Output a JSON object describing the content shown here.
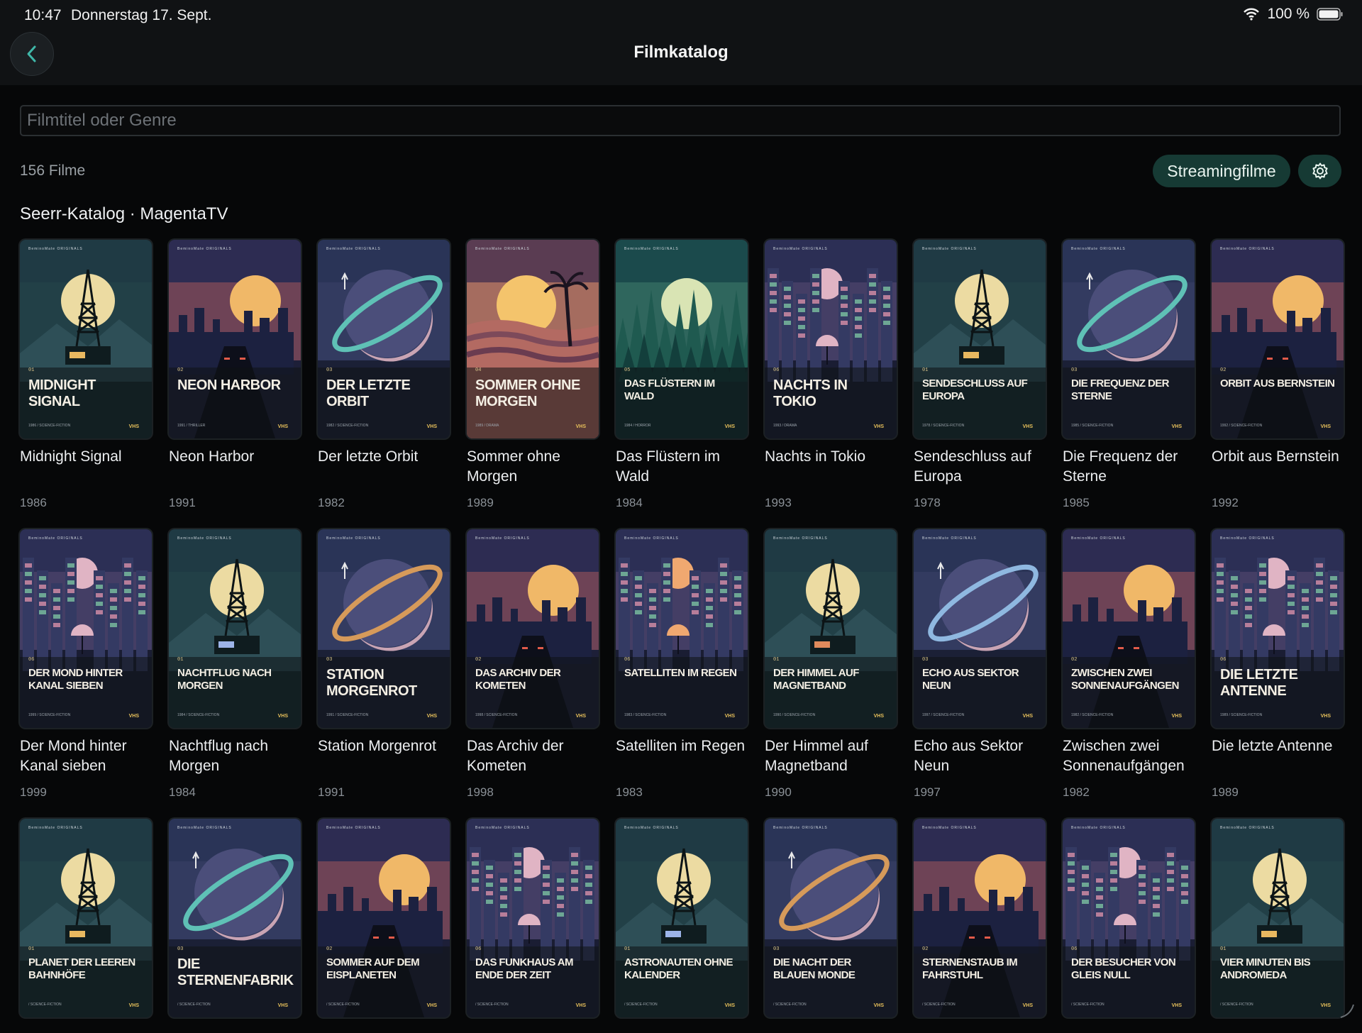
{
  "status": {
    "time": "10:47",
    "date": "Donnerstag 17. Sept.",
    "battery": "100 %"
  },
  "header": {
    "title": "Filmkatalog"
  },
  "search": {
    "placeholder": "Filmtitel oder Genre"
  },
  "toolbar": {
    "count": "156 Filme",
    "streaming_label": "Streamingfilme"
  },
  "section": {
    "title": "Seerr-Katalog · MagentaTV"
  },
  "poster_brand": "BeminoMate  ORIGINALS",
  "poster_badge": "VHS",
  "movies": [
    {
      "title": "Midnight Signal",
      "year": "1986",
      "poster_title": "MIDNIGHT SIGNAL",
      "num": "01",
      "genre": "SCIENCE-FICTION",
      "theme": "tower",
      "palette": "teal",
      "glow": "#e8b860"
    },
    {
      "title": "Neon Harbor",
      "year": "1991",
      "poster_title": "NEON HARBOR",
      "num": "02",
      "genre": "THRILLER",
      "theme": "road",
      "palette": "dusk",
      "glow": "#f2b45c"
    },
    {
      "title": "Der letzte Orbit",
      "year": "1982",
      "poster_title": "DER LETZTE ORBIT",
      "num": "03",
      "genre": "SCIENCE-FICTION",
      "theme": "planet",
      "palette": "indigo",
      "glow": "#5fc1b6"
    },
    {
      "title": "Sommer ohne Morgen",
      "year": "1989",
      "poster_title": "SOMMER OHNE MORGEN",
      "num": "04",
      "genre": "DRAMA",
      "theme": "palm",
      "palette": "sunset",
      "glow": "#f5c46c"
    },
    {
      "title": "Das Flüstern im Wald",
      "year": "1984",
      "poster_title": "DAS FLÜSTERN IM WALD",
      "num": "05",
      "genre": "HORROR",
      "theme": "forest",
      "palette": "forest",
      "glow": "#d9e4b4"
    },
    {
      "title": "Nachts in Tokio",
      "year": "1993",
      "poster_title": "NACHTS IN TOKIO",
      "num": "06",
      "genre": "DRAMA",
      "theme": "city",
      "palette": "violet",
      "glow": "#e0b4c4"
    },
    {
      "title": "Sendeschluss auf Europa",
      "year": "1978",
      "poster_title": "SENDESCHLUSS AUF EUROPA",
      "num": "01",
      "genre": "SCIENCE-FICTION",
      "theme": "tower",
      "palette": "teal",
      "glow": "#e8b860"
    },
    {
      "title": "Die Frequenz der Sterne",
      "year": "1985",
      "poster_title": "DIE FREQUENZ DER STERNE",
      "num": "03",
      "genre": "SCIENCE-FICTION",
      "theme": "planet",
      "palette": "indigo",
      "glow": "#5fc1b6"
    },
    {
      "title": "Orbit aus Bernstein",
      "year": "1992",
      "poster_title": "ORBIT AUS BERNSTEIN",
      "num": "02",
      "genre": "SCIENCE-FICTION",
      "theme": "road",
      "palette": "dusk",
      "glow": "#f2b45c"
    },
    {
      "title": "Der Mond hinter Kanal sieben",
      "year": "1999",
      "poster_title": "DER MOND HINTER KANAL SIEBEN",
      "num": "06",
      "genre": "SCIENCE-FICTION",
      "theme": "city",
      "palette": "violet",
      "glow": "#e0b4c4"
    },
    {
      "title": "Nachtflug nach Morgen",
      "year": "1984",
      "poster_title": "NACHTFLUG NACH MORGEN",
      "num": "01",
      "genre": "SCIENCE-FICTION",
      "theme": "tower",
      "palette": "teal",
      "glow": "#9db4e8"
    },
    {
      "title": "Station Morgenrot",
      "year": "1991",
      "poster_title": "STATION MORGENROT",
      "num": "03",
      "genre": "SCIENCE-FICTION",
      "theme": "planet",
      "palette": "indigo",
      "glow": "#d69a5a"
    },
    {
      "title": "Das Archiv der Kometen",
      "year": "1998",
      "poster_title": "DAS ARCHIV DER KOMETEN",
      "num": "02",
      "genre": "SCIENCE-FICTION",
      "theme": "road",
      "palette": "dusk",
      "glow": "#f2b45c"
    },
    {
      "title": "Satelliten im Regen",
      "year": "1983",
      "poster_title": "SATELLITEN IM REGEN",
      "num": "06",
      "genre": "SCIENCE-FICTION",
      "theme": "city",
      "palette": "violet",
      "glow": "#f0a870"
    },
    {
      "title": "Der Himmel auf Magnetband",
      "year": "1990",
      "poster_title": "DER HIMMEL AUF MAGNETBAND",
      "num": "01",
      "genre": "SCIENCE-FICTION",
      "theme": "tower",
      "palette": "teal",
      "glow": "#e08a5c"
    },
    {
      "title": "Echo aus Sektor Neun",
      "year": "1997",
      "poster_title": "ECHO AUS SEKTOR NEUN",
      "num": "03",
      "genre": "SCIENCE-FICTION",
      "theme": "planet",
      "palette": "indigo",
      "glow": "#8fb8e0"
    },
    {
      "title": "Zwischen zwei Sonnenaufgängen",
      "year": "1982",
      "poster_title": "ZWISCHEN ZWEI SONNENAUFGÄNGEN",
      "num": "02",
      "genre": "SCIENCE-FICTION",
      "theme": "road",
      "palette": "dusk",
      "glow": "#f2b45c"
    },
    {
      "title": "Die letzte Antenne",
      "year": "1989",
      "poster_title": "DIE LETZTE ANTENNE",
      "num": "06",
      "genre": "SCIENCE-FICTION",
      "theme": "city",
      "palette": "violet",
      "glow": "#e0b4c4"
    },
    {
      "title": "",
      "year": "",
      "poster_title": "PLANET DER LEEREN BAHNHÖFE",
      "num": "01",
      "genre": "SCIENCE-FICTION",
      "theme": "tower",
      "palette": "teal",
      "glow": "#e8b860"
    },
    {
      "title": "",
      "year": "",
      "poster_title": "DIE STERNENFABRIK",
      "num": "03",
      "genre": "SCIENCE-FICTION",
      "theme": "planet",
      "palette": "indigo",
      "glow": "#5fc1b6"
    },
    {
      "title": "",
      "year": "",
      "poster_title": "SOMMER AUF DEM EISPLANETEN",
      "num": "02",
      "genre": "SCIENCE-FICTION",
      "theme": "road",
      "palette": "dusk",
      "glow": "#f2b45c"
    },
    {
      "title": "",
      "year": "",
      "poster_title": "DAS FUNKHAUS AM ENDE DER ZEIT",
      "num": "06",
      "genre": "SCIENCE-FICTION",
      "theme": "city",
      "palette": "violet",
      "glow": "#e0b4c4"
    },
    {
      "title": "",
      "year": "",
      "poster_title": "ASTRONAUTEN OHNE KALENDER",
      "num": "01",
      "genre": "SCIENCE-FICTION",
      "theme": "tower",
      "palette": "teal",
      "glow": "#9db4e8"
    },
    {
      "title": "",
      "year": "",
      "poster_title": "DIE NACHT DER BLAUEN MONDE",
      "num": "03",
      "genre": "SCIENCE-FICTION",
      "theme": "planet",
      "palette": "indigo",
      "glow": "#d69a5a"
    },
    {
      "title": "",
      "year": "",
      "poster_title": "STERNENSTAUB IM FAHRSTUHL",
      "num": "02",
      "genre": "SCIENCE-FICTION",
      "theme": "road",
      "palette": "dusk",
      "glow": "#f2b45c"
    },
    {
      "title": "",
      "year": "",
      "poster_title": "DER BESUCHER VON GLEIS NULL",
      "num": "06",
      "genre": "SCIENCE-FICTION",
      "theme": "city",
      "palette": "violet",
      "glow": "#e0b4c4"
    },
    {
      "title": "",
      "year": "",
      "poster_title": "VIER MINUTEN BIS ANDROMEDA",
      "num": "01",
      "genre": "SCIENCE-FICTION",
      "theme": "tower",
      "palette": "teal",
      "glow": "#e8b860"
    }
  ],
  "colors": {
    "accent": "#163a34",
    "background": "#060708",
    "topbar": "#101214",
    "teal_icon": "#3fb7a8"
  }
}
